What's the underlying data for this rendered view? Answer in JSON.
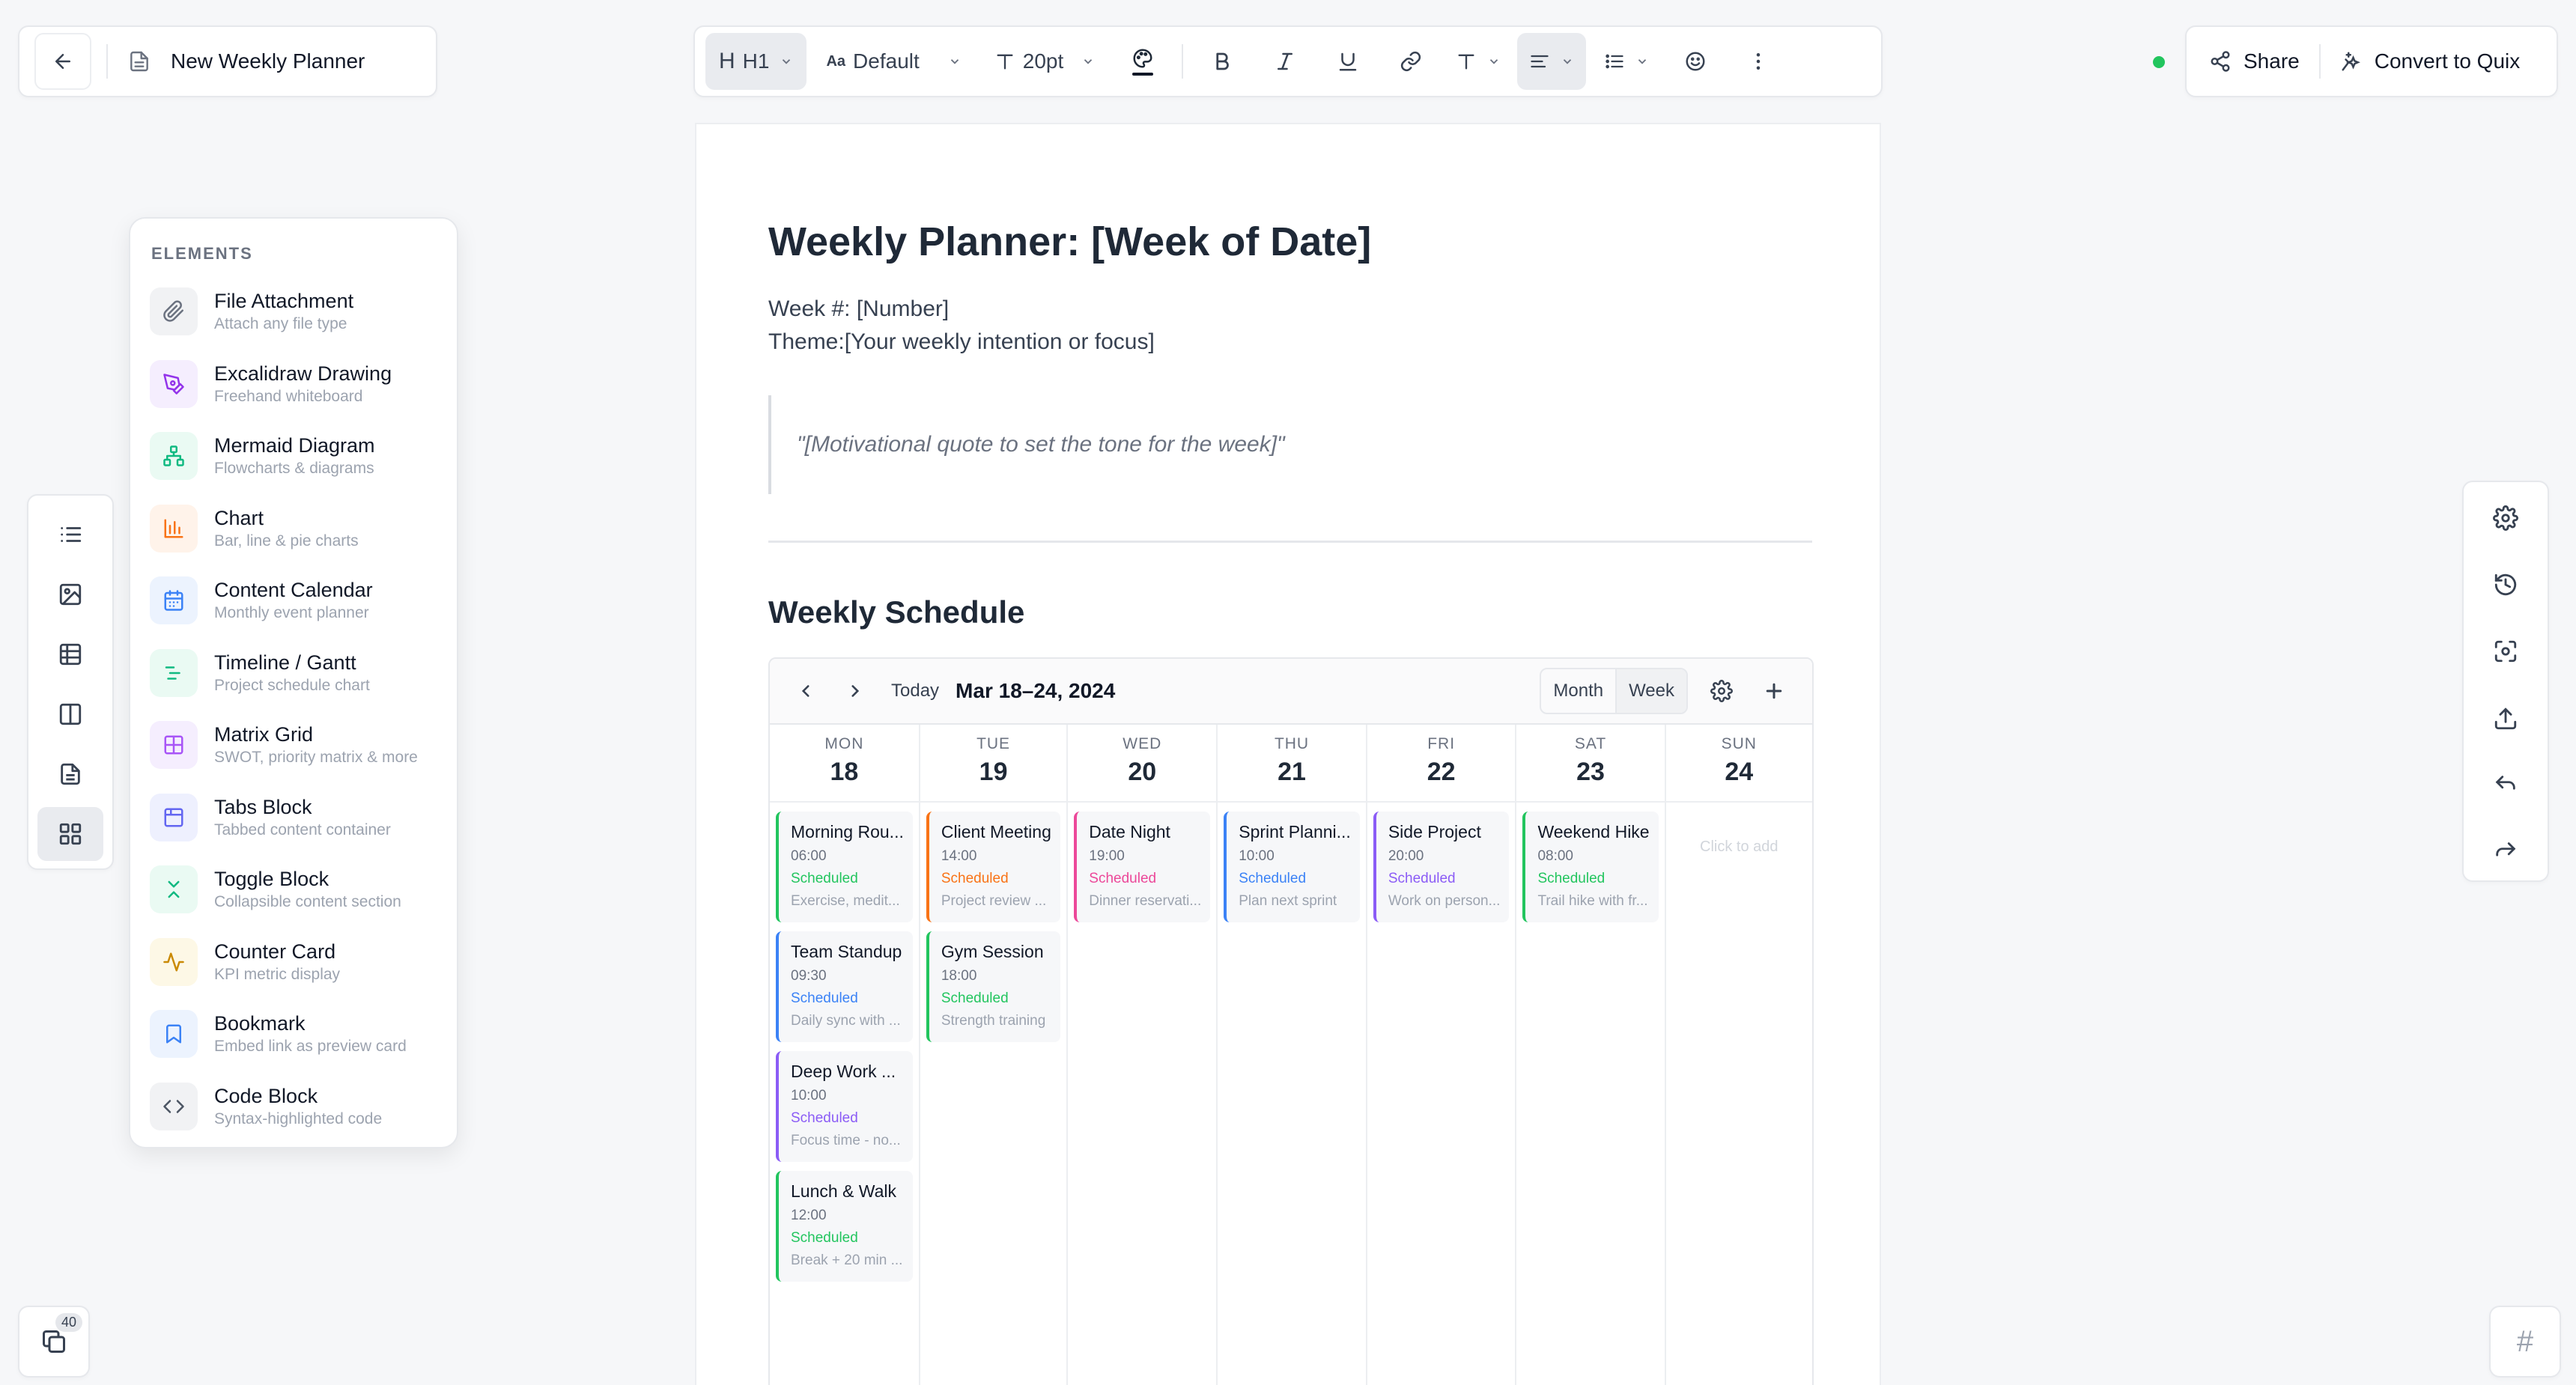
{
  "title_bar": {
    "doc_title": "New Weekly Planner"
  },
  "toolbar": {
    "heading": "H1",
    "font": "Default",
    "font_size": "20pt"
  },
  "actions": {
    "share": "Share",
    "convert": "Convert to Quix"
  },
  "elements_panel": {
    "heading": "ELEMENTS",
    "items": [
      {
        "name": "File Attachment",
        "desc": "Attach any file type",
        "icon": "paperclip-icon",
        "color": "#6b7280",
        "bg": "#f1f2f4"
      },
      {
        "name": "Excalidraw Drawing",
        "desc": "Freehand whiteboard",
        "icon": "pen-icon",
        "color": "#9333ea",
        "bg": "#f5eefe"
      },
      {
        "name": "Mermaid Diagram",
        "desc": "Flowcharts & diagrams",
        "icon": "diagram-icon",
        "color": "#10b981",
        "bg": "#eafaf3"
      },
      {
        "name": "Chart",
        "desc": "Bar, line & pie charts",
        "icon": "bar-chart-icon",
        "color": "#f97316",
        "bg": "#fff3ea"
      },
      {
        "name": "Content Calendar",
        "desc": "Monthly event planner",
        "icon": "calendar-icon",
        "color": "#3b82f6",
        "bg": "#ecf3fe"
      },
      {
        "name": "Timeline / Gantt",
        "desc": "Project schedule chart",
        "icon": "gantt-icon",
        "color": "#10b981",
        "bg": "#eafaf3"
      },
      {
        "name": "Matrix Grid",
        "desc": "SWOT, priority matrix & more",
        "icon": "grid-icon",
        "color": "#a855f7",
        "bg": "#f5eefe"
      },
      {
        "name": "Tabs Block",
        "desc": "Tabbed content container",
        "icon": "tabs-icon",
        "color": "#6366f1",
        "bg": "#eef0fe"
      },
      {
        "name": "Toggle Block",
        "desc": "Collapsible content section",
        "icon": "collapse-icon",
        "color": "#10b981",
        "bg": "#eafaf3"
      },
      {
        "name": "Counter Card",
        "desc": "KPI metric display",
        "icon": "pulse-icon",
        "color": "#ca8a04",
        "bg": "#fdf8e6"
      },
      {
        "name": "Bookmark",
        "desc": "Embed link as preview card",
        "icon": "bookmark-icon",
        "color": "#3b82f6",
        "bg": "#ecf3fe"
      },
      {
        "name": "Code Block",
        "desc": "Syntax-highlighted code",
        "icon": "code-icon",
        "color": "#4b5563",
        "bg": "#f1f2f4"
      }
    ]
  },
  "document": {
    "h1": "Weekly Planner: [Week of Date]",
    "week_line": "Week #: [Number]",
    "theme_line": "Theme:[Your weekly intention or focus]",
    "quote": "\"[Motivational quote to set the tone for the week]\"",
    "h2": "Weekly Schedule"
  },
  "calendar": {
    "today": "Today",
    "range": "Mar 18–24, 2024",
    "view_month": "Month",
    "view_week": "Week",
    "empty_hint": "Click to add",
    "days": [
      {
        "name": "MON",
        "num": "18",
        "events": [
          {
            "title": "Morning Rou...",
            "time": "06:00",
            "status": "Scheduled",
            "desc": "Exercise, medit...",
            "color": "#22c55e"
          },
          {
            "title": "Team Standup",
            "time": "09:30",
            "status": "Scheduled",
            "desc": "Daily sync with ...",
            "color": "#3b82f6"
          },
          {
            "title": "Deep Work ...",
            "time": "10:00",
            "status": "Scheduled",
            "desc": "Focus time - no...",
            "color": "#8b5cf6"
          },
          {
            "title": "Lunch & Walk",
            "time": "12:00",
            "status": "Scheduled",
            "desc": "Break + 20 min ...",
            "color": "#22c55e"
          }
        ]
      },
      {
        "name": "TUE",
        "num": "19",
        "events": [
          {
            "title": "Client Meeting",
            "time": "14:00",
            "status": "Scheduled",
            "desc": "Project review ...",
            "color": "#f97316"
          },
          {
            "title": "Gym Session",
            "time": "18:00",
            "status": "Scheduled",
            "desc": "Strength training",
            "color": "#22c55e"
          }
        ]
      },
      {
        "name": "WED",
        "num": "20",
        "events": [
          {
            "title": "Date Night",
            "time": "19:00",
            "status": "Scheduled",
            "desc": "Dinner reservati...",
            "color": "#ec4899"
          }
        ]
      },
      {
        "name": "THU",
        "num": "21",
        "events": [
          {
            "title": "Sprint Planni...",
            "time": "10:00",
            "status": "Scheduled",
            "desc": "Plan next sprint",
            "color": "#3b82f6"
          }
        ]
      },
      {
        "name": "FRI",
        "num": "22",
        "events": [
          {
            "title": "Side Project",
            "time": "20:00",
            "status": "Scheduled",
            "desc": "Work on person...",
            "color": "#8b5cf6"
          }
        ]
      },
      {
        "name": "SAT",
        "num": "23",
        "events": [
          {
            "title": "Weekend Hike",
            "time": "08:00",
            "status": "Scheduled",
            "desc": "Trail hike with fr...",
            "color": "#22c55e"
          }
        ]
      },
      {
        "name": "SUN",
        "num": "24",
        "events": []
      }
    ]
  },
  "pages_badge": {
    "count": "40"
  },
  "hash_button": {
    "label": "#"
  }
}
